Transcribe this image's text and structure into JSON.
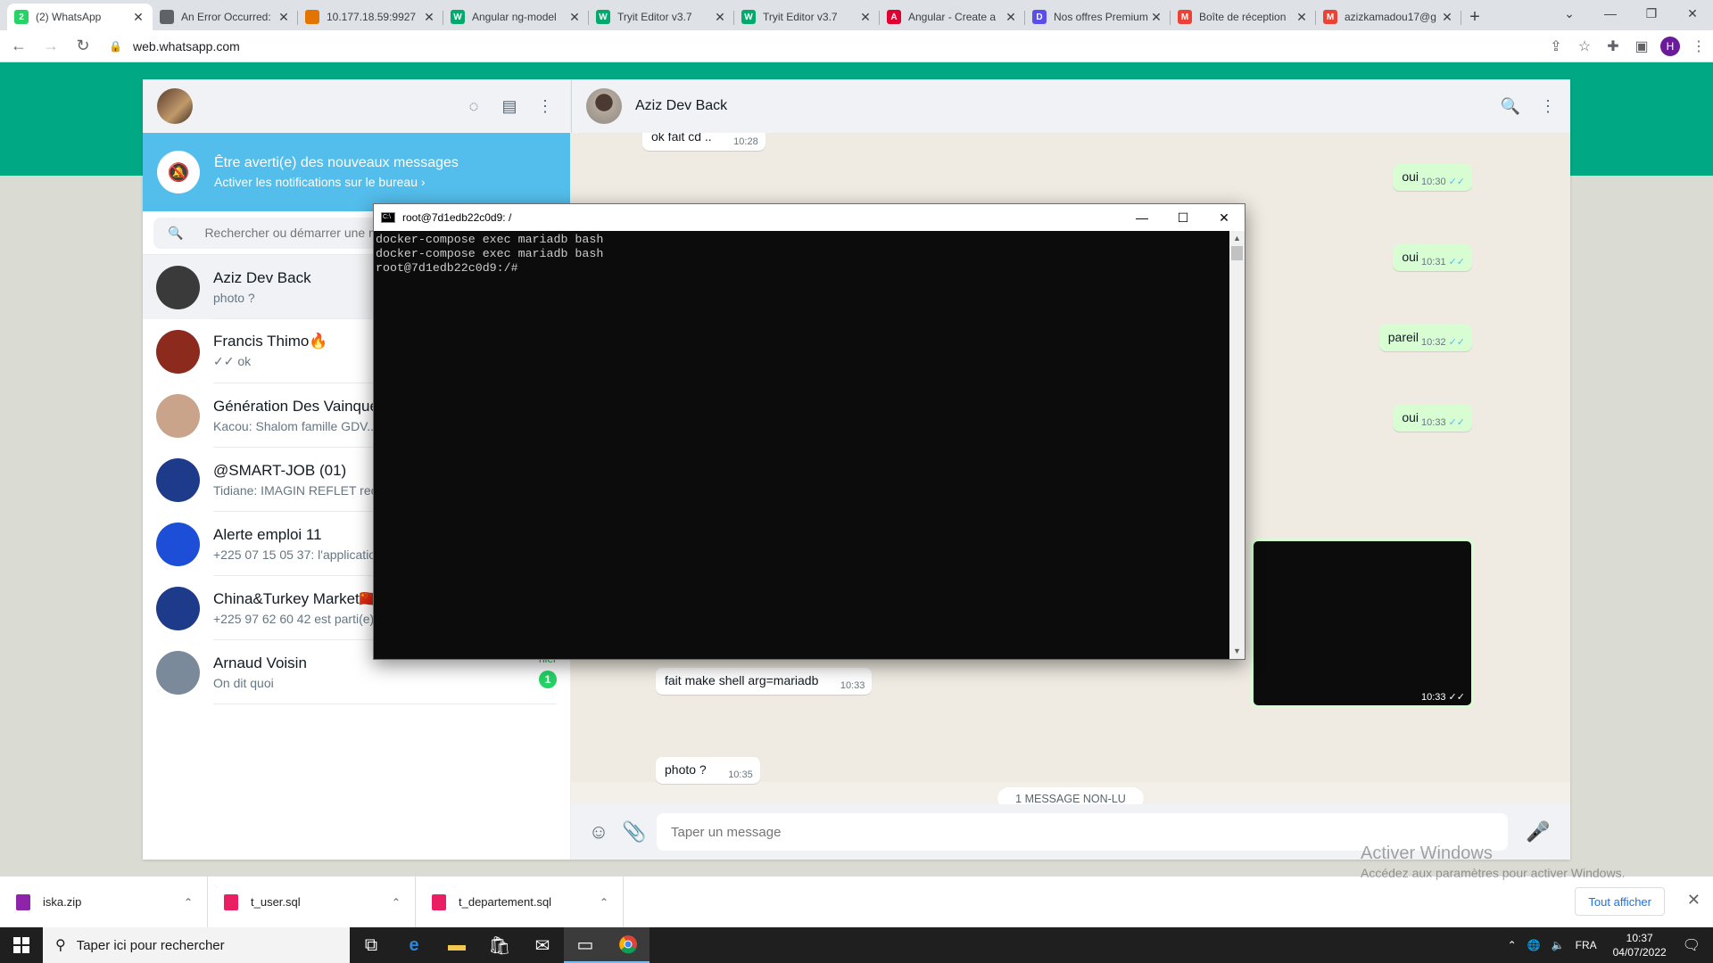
{
  "browser": {
    "tabs": [
      {
        "title": "(2) WhatsApp",
        "favicon": "whatsapp-icon",
        "color": "#25d366",
        "fav_text": "2"
      },
      {
        "title": "An Error Occurred:",
        "favicon": "globe-icon",
        "color": "#5f6368",
        "fav_text": ""
      },
      {
        "title": "10.177.18.59:9927",
        "favicon": "warning-icon",
        "color": "#e37400",
        "fav_text": ""
      },
      {
        "title": "Angular ng-model",
        "favicon": "w3schools-icon",
        "color": "#04aa6d",
        "fav_text": "W"
      },
      {
        "title": "Tryit Editor v3.7",
        "favicon": "w3schools-icon",
        "color": "#04aa6d",
        "fav_text": "W"
      },
      {
        "title": "Tryit Editor v3.7",
        "favicon": "w3schools-icon",
        "color": "#04aa6d",
        "fav_text": "W"
      },
      {
        "title": "Angular - Create a",
        "favicon": "angular-icon",
        "color": "#dd0031",
        "fav_text": "A"
      },
      {
        "title": "Nos offres Premium",
        "favicon": "brand-icon",
        "color": "#5b4fe9",
        "fav_text": "D"
      },
      {
        "title": "Boîte de réception",
        "favicon": "gmail-icon",
        "color": "#ea4335",
        "fav_text": "M"
      },
      {
        "title": "azizkamadou17@g",
        "favicon": "gmail-icon",
        "color": "#ea4335",
        "fav_text": "M"
      }
    ],
    "url": "web.whatsapp.com",
    "profile_initial": "H"
  },
  "sidebar": {
    "notification": {
      "title": "Être averti(e) des nouveaux messages",
      "subtitle": "Activer les notifications sur le bureau ›"
    },
    "search_placeholder": "Rechercher ou démarrer une nouvelle discussion",
    "chats": [
      {
        "name": "Aziz Dev Back",
        "last": "photo ?",
        "meta": "",
        "badge": "",
        "color": "#3a3a3a"
      },
      {
        "name": "Francis Thimo🔥",
        "last": "✓✓ ok",
        "meta": "",
        "badge": "",
        "color": "#8b2a1d"
      },
      {
        "name": "Génération Des Vainqueurs",
        "last": "Kacou: Shalom famille GDV...",
        "meta": "",
        "badge": "",
        "color": "#c9a48a"
      },
      {
        "name": "@SMART-JOB (01)",
        "last": "Tidiane: IMAGIN REFLET recrute",
        "meta": "",
        "badge": "",
        "color": "#1e3a8a"
      },
      {
        "name": "Alerte emploi 11",
        "last": "+225 07 15 05 37: l'application",
        "meta": "",
        "badge": "",
        "color": "#1d4ed8"
      },
      {
        "name": "China&Turkey Market🇨🇳",
        "last": "+225 97 62 60 42 est parti(e)",
        "meta": "",
        "badge": "",
        "color": "#1e3a8a"
      },
      {
        "name": "Arnaud Voisin",
        "last": "On dit quoi",
        "meta": "hier",
        "badge": "1",
        "color": "#7a8a9a"
      }
    ]
  },
  "conversation": {
    "contact": "Aziz Dev Back",
    "messages": [
      {
        "text": "ok fait cd ..",
        "time": "10:28",
        "dir": "in",
        "ticks": ""
      },
      {
        "text": "oui",
        "time": "10:30",
        "dir": "out",
        "ticks": "✓✓"
      },
      {
        "text": "oui",
        "time": "10:31",
        "dir": "out",
        "ticks": "✓✓"
      },
      {
        "text": "pareil",
        "time": "10:32",
        "dir": "out",
        "ticks": "✓✓"
      },
      {
        "text": "oui",
        "time": "10:33",
        "dir": "out",
        "ticks": "✓✓"
      },
      {
        "text": "fait make shell arg=mariadb",
        "time": "10:33",
        "dir": "in",
        "ticks": ""
      },
      {
        "text": "photo ?",
        "time": "10:35",
        "dir": "in",
        "ticks": ""
      }
    ],
    "image_time": "10:33 ✓✓",
    "unread_label": "1 MESSAGE NON-LU",
    "composer_placeholder": "Taper un message"
  },
  "console": {
    "title": "root@7d1edb22c0d9: /",
    "lines": "docker-compose exec mariadb bash\ndocker-compose exec mariadb bash\nroot@7d1edb22c0d9:/#"
  },
  "downloads": {
    "items": [
      {
        "name": "iska.zip",
        "color": "#8e24aa"
      },
      {
        "name": "t_user.sql",
        "color": "#e91e63"
      },
      {
        "name": "t_departement.sql",
        "color": "#e91e63"
      }
    ],
    "show_all": "Tout afficher"
  },
  "watermark": {
    "line1": "Activer Windows",
    "line2": "Accédez aux paramètres pour activer Windows."
  },
  "taskbar": {
    "search_placeholder": "Taper ici pour rechercher",
    "lang": "FRA",
    "time": "10:37",
    "date": "04/07/2022"
  },
  "colors": {
    "accent": "#00a884",
    "notification": "#53bdeb",
    "outgoing": "#d9fdd3",
    "read_ticks": "#53bdeb"
  }
}
